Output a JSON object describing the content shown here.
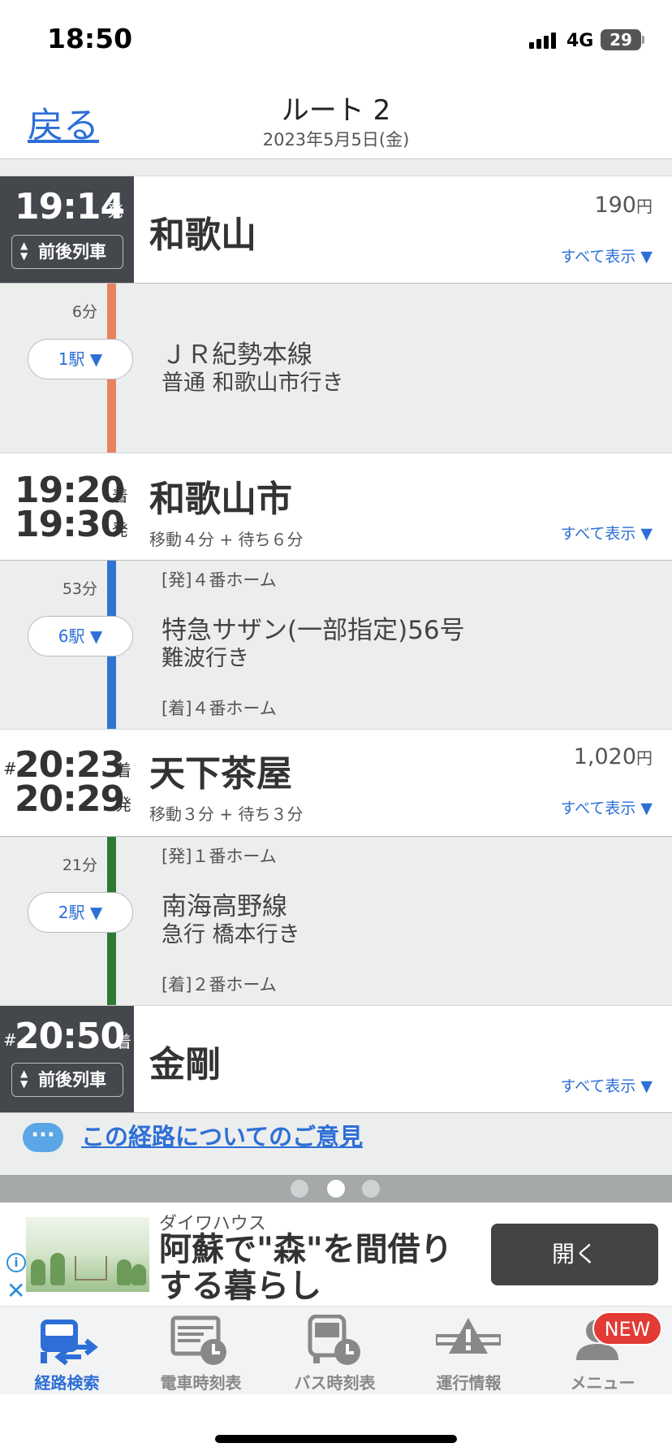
{
  "status_bar": {
    "time": "18:50",
    "network": "4G",
    "battery": "29"
  },
  "nav": {
    "back_label": "戻る",
    "title": "ルート 2",
    "date": "2023年5月5日(金)"
  },
  "stations": [
    {
      "prefix": "",
      "time1": "19:14",
      "suffix1": "発",
      "time2": "",
      "suffix2": "",
      "name": "和歌山",
      "sub": "",
      "fare": "190",
      "fare_unit": "円",
      "show_all": "すべて表示 ▼",
      "near_trains": "前後列車"
    },
    {
      "prefix": "",
      "time1": "19:20",
      "suffix1": "着",
      "time2": "19:30",
      "suffix2": "発",
      "name": "和歌山市",
      "sub": "移動４分 + 待ち６分",
      "fare": "",
      "fare_unit": "",
      "show_all": "すべて表示 ▼",
      "near_trains": ""
    },
    {
      "prefix": "#",
      "time1": "20:23",
      "suffix1": "着",
      "time2": "20:29",
      "suffix2": "発",
      "name": "天下茶屋",
      "sub": "移動３分 + 待ち３分",
      "fare": "1,020",
      "fare_unit": "円",
      "show_all": "すべて表示 ▼",
      "near_trains": ""
    },
    {
      "prefix": "#",
      "time1": "20:50",
      "suffix1": "着",
      "time2": "",
      "suffix2": "",
      "name": "金剛",
      "sub": "",
      "fare": "",
      "fare_unit": "",
      "show_all": "すべて表示 ▼",
      "near_trains": "前後列車"
    }
  ],
  "segments": [
    {
      "duration": "6分",
      "stops": "1駅 ▼",
      "depart_platform": "",
      "line": "ＪＲ紀勢本線",
      "direction": "普通 和歌山市行き",
      "arrive_platform": "",
      "color": "#e8825f"
    },
    {
      "duration": "53分",
      "stops": "6駅 ▼",
      "depart_platform": "[発]４番ホーム",
      "line": "特急サザン(一部指定)56号",
      "direction": "難波行き",
      "arrive_platform": "[着]４番ホーム",
      "color": "#2f74d0"
    },
    {
      "duration": "21分",
      "stops": "2駅 ▼",
      "depart_platform": "[発]１番ホーム",
      "line": "南海高野線",
      "direction": "急行 橋本行き",
      "arrive_platform": "[着]２番ホーム",
      "color": "#2e7a34"
    }
  ],
  "feedback": {
    "icon": "speech-bubble-icon",
    "label": "この経路についてのご意見"
  },
  "pager": {
    "count": 3,
    "active": 1
  },
  "ad": {
    "sponsor": "ダイワハウス",
    "headline": "阿蘇で\"森\"を間借りする暮らし",
    "button": "開く"
  },
  "tabs": [
    {
      "label": "経路検索",
      "icon": "train-route-icon",
      "active": true
    },
    {
      "label": "電車時刻表",
      "icon": "train-timetable-icon",
      "active": false
    },
    {
      "label": "バス時刻表",
      "icon": "bus-timetable-icon",
      "active": false
    },
    {
      "label": "運行情報",
      "icon": "service-alert-icon",
      "active": false
    },
    {
      "label": "メニュー",
      "icon": "menu-person-icon",
      "active": false
    }
  ],
  "badge": "NEW",
  "colors": {
    "accent": "#2d6fd6",
    "dark": "#44474c",
    "badge": "#e23a35"
  }
}
